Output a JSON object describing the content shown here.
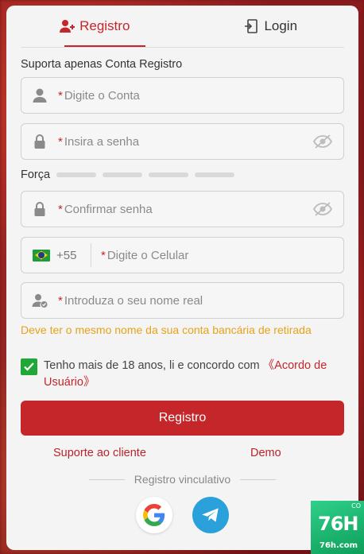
{
  "tabs": {
    "register_label": "Registro",
    "login_label": "Login"
  },
  "hint": "Suporta apenas Conta Registro",
  "fields": {
    "account_placeholder": "Digite o Conta",
    "password_placeholder": "Insira a senha",
    "confirm_placeholder": "Confirmar senha",
    "phone_code": "+55",
    "phone_placeholder": "Digite o Celular",
    "realname_placeholder": "Introduza o seu nome real",
    "required_mark": "*"
  },
  "strength_label": "Força",
  "realname_warning": "Deve ter o mesmo nome da sua conta bancária de retirada",
  "agreement": {
    "text": "Tenho mais de 18 anos, li e concordo com ",
    "link": "《Acordo de Usuário》",
    "checked": true
  },
  "submit_label": "Registro",
  "links": {
    "support": "Suporte ao cliente",
    "demo": "Demo"
  },
  "social_divider": "Registro vinculativo",
  "badge": {
    "big": "76H",
    "small": "76h.com",
    "tiny": "CO"
  },
  "colors": {
    "accent": "#c4262a",
    "warning": "#e6a21a",
    "check": "#1fa838"
  }
}
